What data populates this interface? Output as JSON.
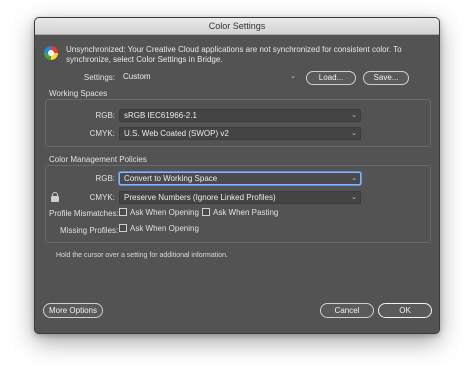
{
  "window": {
    "title": "Color Settings"
  },
  "warning": {
    "icon": "color-wheel-icon",
    "text": "Unsynchronized: Your Creative Cloud applications are not synchronized for consistent color. To synchronize, select Color Settings in Bridge."
  },
  "settings": {
    "label": "Settings:",
    "value": "Custom",
    "load_label": "Load...",
    "save_label": "Save..."
  },
  "working_spaces": {
    "title": "Working Spaces",
    "rgb_label": "RGB:",
    "rgb_value": "sRGB IEC61966-2.1",
    "cmyk_label": "CMYK:",
    "cmyk_value": "U.S. Web Coated (SWOP) v2"
  },
  "policies": {
    "title": "Color Management Policies",
    "rgb_label": "RGB:",
    "rgb_value": "Convert to Working Space",
    "cmyk_label": "CMYK:",
    "cmyk_value": "Preserve Numbers (Ignore Linked Profiles)",
    "mismatch_label": "Profile Mismatches:",
    "ask_opening_label": "Ask When Opening",
    "ask_pasting_label": "Ask When Pasting",
    "missing_label": "Missing Profiles:",
    "missing_ask_opening_label": "Ask When Opening"
  },
  "hint": "Hold the cursor over a setting for additional information.",
  "footer": {
    "more_options_label": "More Options",
    "cancel_label": "Cancel",
    "ok_label": "OK"
  }
}
